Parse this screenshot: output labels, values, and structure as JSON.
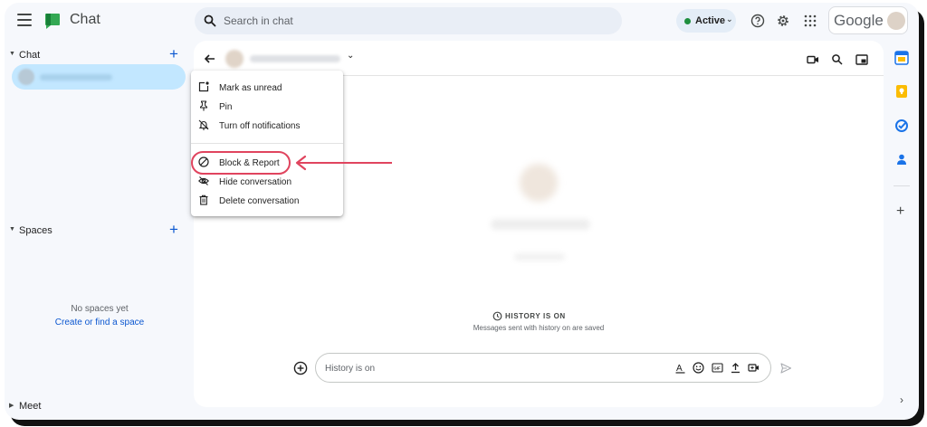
{
  "header": {
    "app_title": "Chat",
    "search_placeholder": "Search in chat",
    "status": "Active",
    "brand": "Google"
  },
  "sidebar": {
    "chat_label": "Chat",
    "spaces_label": "Spaces",
    "meet_label": "Meet",
    "no_spaces": "No spaces yet",
    "create_space": "Create or find a space"
  },
  "menu": {
    "items": [
      {
        "label": "Mark as unread",
        "icon": "mark-unread-icon"
      },
      {
        "label": "Pin",
        "icon": "pin-icon"
      },
      {
        "label": "Turn off notifications",
        "icon": "notifications-off-icon"
      },
      {
        "label": "Block & Report",
        "icon": "block-icon"
      },
      {
        "label": "Hide conversation",
        "icon": "hide-icon"
      },
      {
        "label": "Delete conversation",
        "icon": "trash-icon"
      }
    ]
  },
  "main": {
    "history_on": "HISTORY IS ON",
    "history_sub": "Messages sent with history on are saved",
    "composer_placeholder": "History is on"
  },
  "colors": {
    "accent": "#0b57d0",
    "selected_bg": "#c2e7ff",
    "active_status": "#1e8e3e",
    "annotation": "#e0445e"
  }
}
